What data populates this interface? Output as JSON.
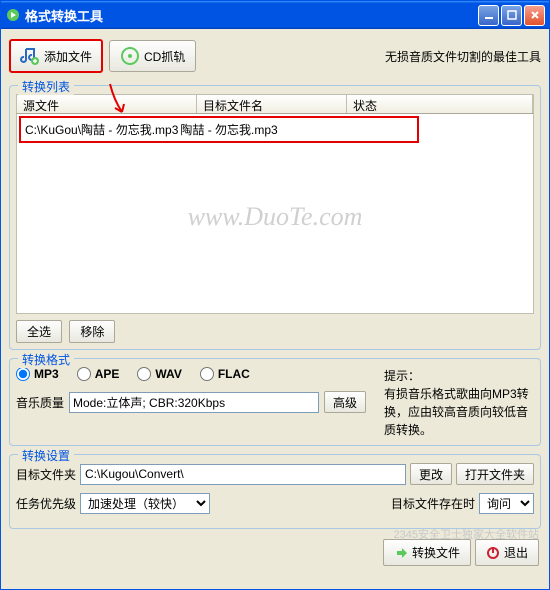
{
  "window": {
    "title": "格式转换工具"
  },
  "toolbar": {
    "add_file": "添加文件",
    "cd_rip": "CD抓轨"
  },
  "tagline": "无损音质文件切割的最佳工具",
  "list": {
    "legend": "转换列表",
    "col_source": "源文件",
    "col_target": "目标文件名",
    "col_status": "状态",
    "rows": [
      {
        "source": "C:\\KuGou\\陶喆 - 勿忘我.mp3",
        "target": "陶喆 - 勿忘我.mp3",
        "status": ""
      }
    ],
    "select_all": "全选",
    "remove": "移除"
  },
  "watermark": "www.DuoTe.com",
  "format": {
    "legend": "转换格式",
    "options": {
      "mp3": "MP3",
      "ape": "APE",
      "wav": "WAV",
      "flac": "FLAC"
    },
    "selected": "mp3",
    "quality_label": "音乐质量",
    "quality_value": "Mode:立体声; CBR:320Kbps",
    "advanced": "高级",
    "hint_title": "提示：",
    "hint_body": "有损音乐格式歌曲向MP3转换，应由较高音质向较低音质转换。"
  },
  "settings": {
    "legend": "转换设置",
    "target_folder_label": "目标文件夹",
    "target_folder_value": "C:\\Kugou\\Convert\\",
    "change": "更改",
    "open_folder": "打开文件夹",
    "priority_label": "任务优先级",
    "priority_value": "加速处理（较快）",
    "exists_label": "目标文件存在时",
    "exists_value": "询问"
  },
  "actions": {
    "convert": "转换文件",
    "exit": "退出"
  },
  "wm_small": "2345安全卫士独家大全软件站"
}
